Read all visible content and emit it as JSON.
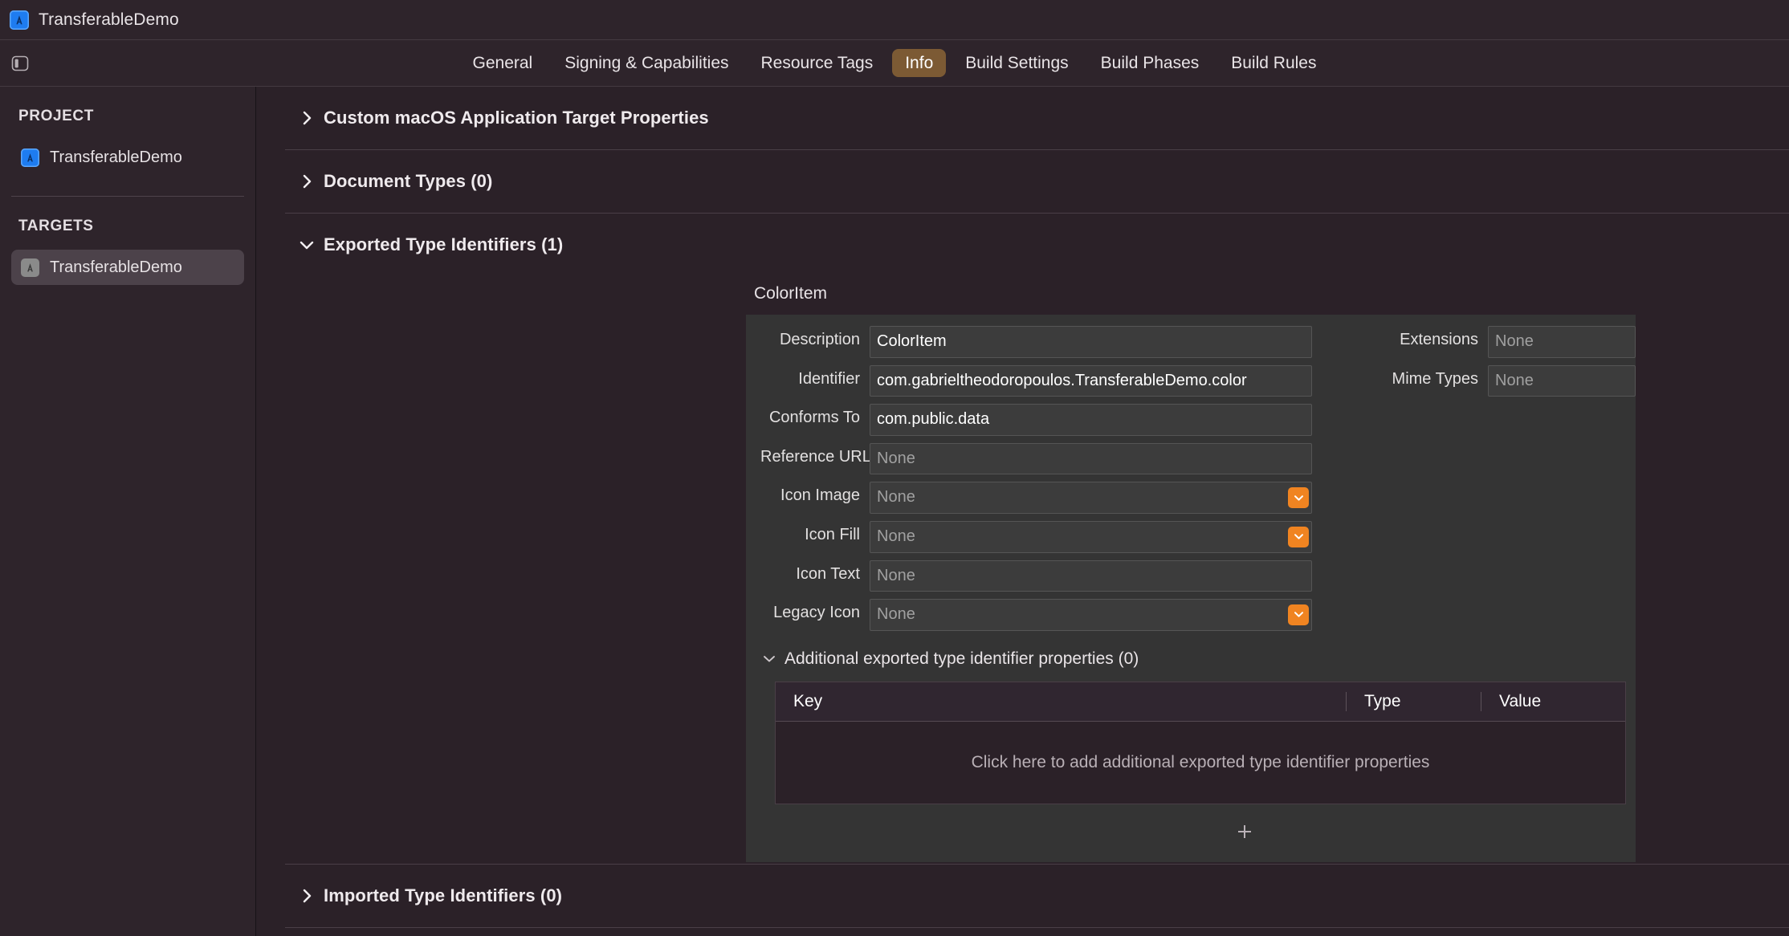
{
  "window": {
    "title": "TransferableDemo",
    "app_icon": "xcode-app-icon"
  },
  "toolbar": {
    "sidebar_toggle_icon": "sidebar-toggle-icon",
    "tabs": [
      {
        "label": "General",
        "active": false
      },
      {
        "label": "Signing & Capabilities",
        "active": false
      },
      {
        "label": "Resource Tags",
        "active": false
      },
      {
        "label": "Info",
        "active": true
      },
      {
        "label": "Build Settings",
        "active": false
      },
      {
        "label": "Build Phases",
        "active": false
      },
      {
        "label": "Build Rules",
        "active": false
      }
    ],
    "active_tab_color": "#7c5a34"
  },
  "sidebar": {
    "project_header": "PROJECT",
    "project_item": "TransferableDemo",
    "targets_header": "TARGETS",
    "target_item": "TransferableDemo"
  },
  "main": {
    "sections": [
      {
        "title": "Custom macOS Application Target Properties",
        "expanded": false
      },
      {
        "title": "Document Types (0)",
        "expanded": false
      },
      {
        "title": "Exported Type Identifiers (1)",
        "expanded": true
      },
      {
        "title": "Imported Type Identifiers (0)",
        "expanded": false
      }
    ],
    "exported_type": {
      "item_name": "ColorItem",
      "fields_left": [
        {
          "label": "Description",
          "value": "ColorItem",
          "placeholder": false,
          "stepper": false,
          "multiline": false
        },
        {
          "label": "Identifier",
          "value": "com.gabrieltheodoropoulos.TransferableDemo.color",
          "placeholder": false,
          "stepper": false,
          "multiline": true
        },
        {
          "label": "Conforms To",
          "value": "com.public.data",
          "placeholder": false,
          "stepper": false,
          "multiline": false
        },
        {
          "label": "Reference URL",
          "value": "None",
          "placeholder": true,
          "stepper": false,
          "multiline": false
        },
        {
          "label": "Icon Image",
          "value": "None",
          "placeholder": true,
          "stepper": true,
          "multiline": false
        },
        {
          "label": "Icon Fill",
          "value": "None",
          "placeholder": true,
          "stepper": true,
          "multiline": false
        },
        {
          "label": "Icon Text",
          "value": "None",
          "placeholder": true,
          "stepper": false,
          "multiline": false
        },
        {
          "label": "Legacy Icon",
          "value": "None",
          "placeholder": true,
          "stepper": true,
          "multiline": false
        }
      ],
      "fields_right": [
        {
          "label": "Extensions",
          "value": "None",
          "placeholder": true
        },
        {
          "label": "Mime Types",
          "value": "None",
          "placeholder": true
        }
      ],
      "additional": {
        "title": "Additional exported type identifier properties (0)",
        "expanded": true,
        "columns": [
          "Key",
          "Type",
          "Value"
        ],
        "rows": [],
        "empty_text": "Click here to add additional exported type identifier properties"
      },
      "add_button_icon": "plus-icon"
    }
  },
  "colors": {
    "window_background": "#2b2128",
    "chrome_background": "#2e242b",
    "panel_background": "#343434",
    "field_background": "#3c3c3c",
    "accent_orange": "#f08421",
    "accent_blue": "#1e7cf0",
    "tab_active": "#7c5a34",
    "selection": "#4c424a"
  }
}
